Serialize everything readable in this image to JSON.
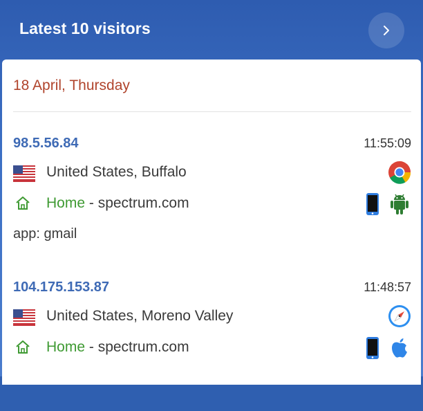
{
  "header": {
    "title": "Latest 10 visitors",
    "next_icon": "chevron-right-icon"
  },
  "date_label": "18 April, Thursday",
  "visits": [
    {
      "ip": "98.5.56.84",
      "time": "11:55:09",
      "flag_icon": "us-flag-icon",
      "location": "United States, Buffalo",
      "page_label": "Home",
      "separator": " - ",
      "referrer": "spectrum.com",
      "app": "app: gmail",
      "browser_icon": "chrome-icon",
      "device_icon": "mobile-phone-icon",
      "os_icon": "android-icon"
    },
    {
      "ip": "104.175.153.87",
      "time": "11:48:57",
      "flag_icon": "us-flag-icon",
      "location": "United States, Moreno Valley",
      "page_label": "Home",
      "separator": " - ",
      "referrer": "spectrum.com",
      "browser_icon": "safari-icon",
      "device_icon": "mobile-phone-icon",
      "os_icon": "apple-icon"
    }
  ],
  "colors": {
    "header_bg": "#3c6fc4",
    "ip": "#3e6ab5",
    "date": "#b0442c",
    "page_link": "#3f9a33"
  }
}
